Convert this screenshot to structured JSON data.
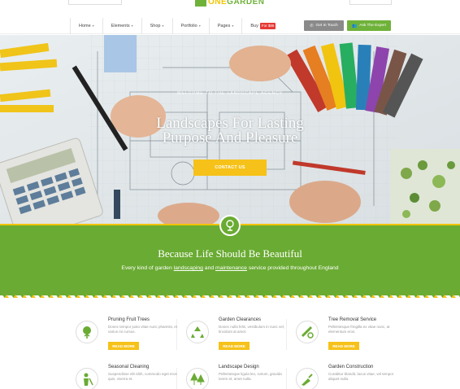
{
  "logo": {
    "text_a": "ONE",
    "text_b": "GARDEN"
  },
  "nav": {
    "items": [
      {
        "label": "Home",
        "caret": true
      },
      {
        "label": "Elements",
        "caret": true
      },
      {
        "label": "Shop",
        "caret": true
      },
      {
        "label": "Portfolio",
        "caret": true
      },
      {
        "label": "Pages",
        "caret": true
      },
      {
        "label": "Buy",
        "caret": false,
        "badge": "For $86"
      }
    ],
    "get_in_touch": "Get In Touch",
    "ask_expert": "Ask The Expert"
  },
  "hero": {
    "eyebrow": "Welcome to the landscape agency",
    "title_line1": "Landscapes For Lasting",
    "title_line2": "Purpose And Pleasure",
    "cta": "CONTACT US"
  },
  "band": {
    "title": "Because Life Should Be Beautiful",
    "sub_pre": "Every kind of garden ",
    "sub_link1": "landscaping",
    "sub_mid": " and ",
    "sub_link2": "maintenance",
    "sub_post": " service provided throughout England"
  },
  "services": [
    {
      "title": "Pruning Fruit Trees",
      "text": "Donec tempor justo vitae nunc pharetra, et varius mi cursus.",
      "more": "READ MORE",
      "icon": "tree-icon"
    },
    {
      "title": "Garden Clearances",
      "text": "Donec nulla felis, vestibulum in nunc vel, tincidunt at amet.",
      "more": "READ MORE",
      "icon": "recycle-icon"
    },
    {
      "title": "Tree Removal Service",
      "text": "Pellentesque fringilla ex vitae nunc, at elementum eros.",
      "more": "READ MORE",
      "icon": "saw-icon"
    },
    {
      "title": "Seasonal Cleaning",
      "text": "Suspendisse elit nibh, commodo eget eros quis, viverra et.",
      "more": "",
      "icon": "gardener-icon"
    },
    {
      "title": "Landscape Design",
      "text": "Pellentesque ligula leo, rutrum, gravida lorem et, amet nulla.",
      "more": "",
      "icon": "trees-icon"
    },
    {
      "title": "Garden Construction",
      "text": "Curabitur blandit, lacus vitae, vel tempor aliquet nulla.",
      "more": "",
      "icon": "trowel-icon"
    }
  ],
  "colors": {
    "green": "#6aab33",
    "yellow": "#f6c21a",
    "grey_button": "#8a8a8a",
    "badge_red": "#e53935"
  }
}
